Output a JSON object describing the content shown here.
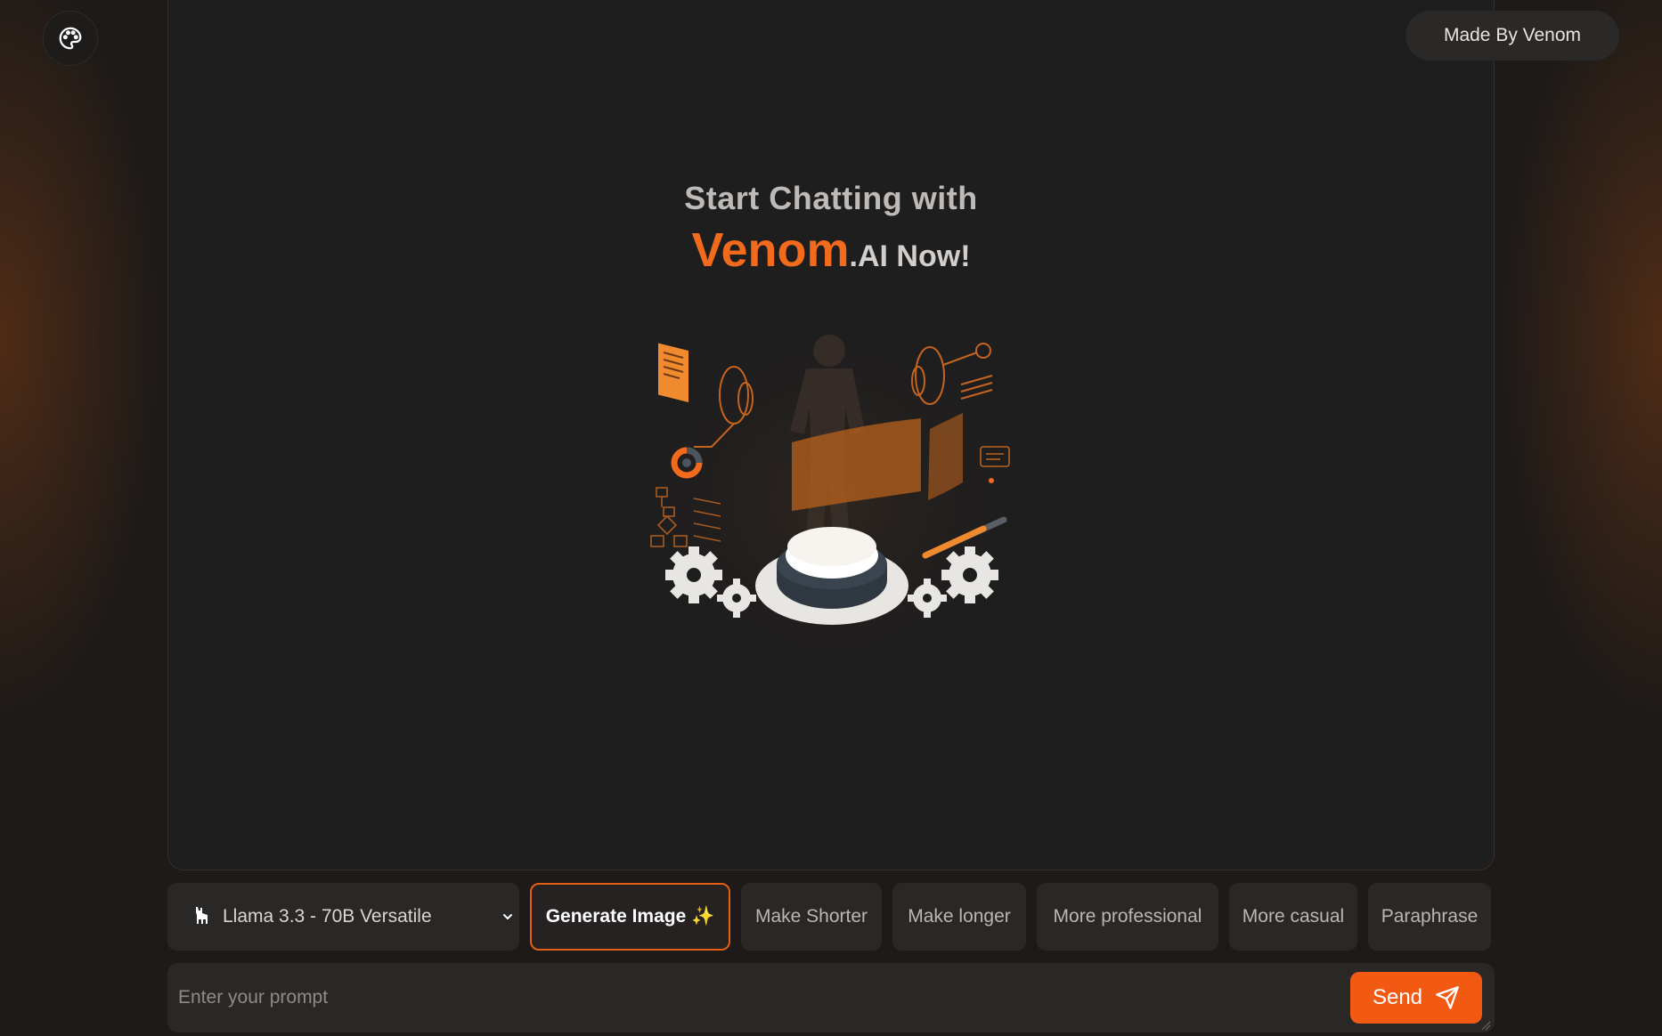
{
  "header": {
    "theme_icon": "palette-icon",
    "made_by": "Made By Venom"
  },
  "hero": {
    "line1": "Start Chatting with",
    "brand": "Venom",
    "brand_suffix": ".AI Now!",
    "illustration_icon": "ai-hologram-illustration"
  },
  "toolbar": {
    "model_icon": "llama-icon",
    "model": "Llama 3.3 - 70B Versatile",
    "generate_image": "Generate Image ✨",
    "actions": [
      "Make Shorter",
      "Make longer",
      "More professional",
      "More casual",
      "Paraphrase"
    ]
  },
  "composer": {
    "placeholder": "Enter your prompt",
    "send": "Send",
    "send_icon": "paper-plane-icon"
  },
  "colors": {
    "accent": "#f26a1b",
    "background": "#1d1a19",
    "panel": "#1f1e1e",
    "chip": "#2a2827"
  }
}
